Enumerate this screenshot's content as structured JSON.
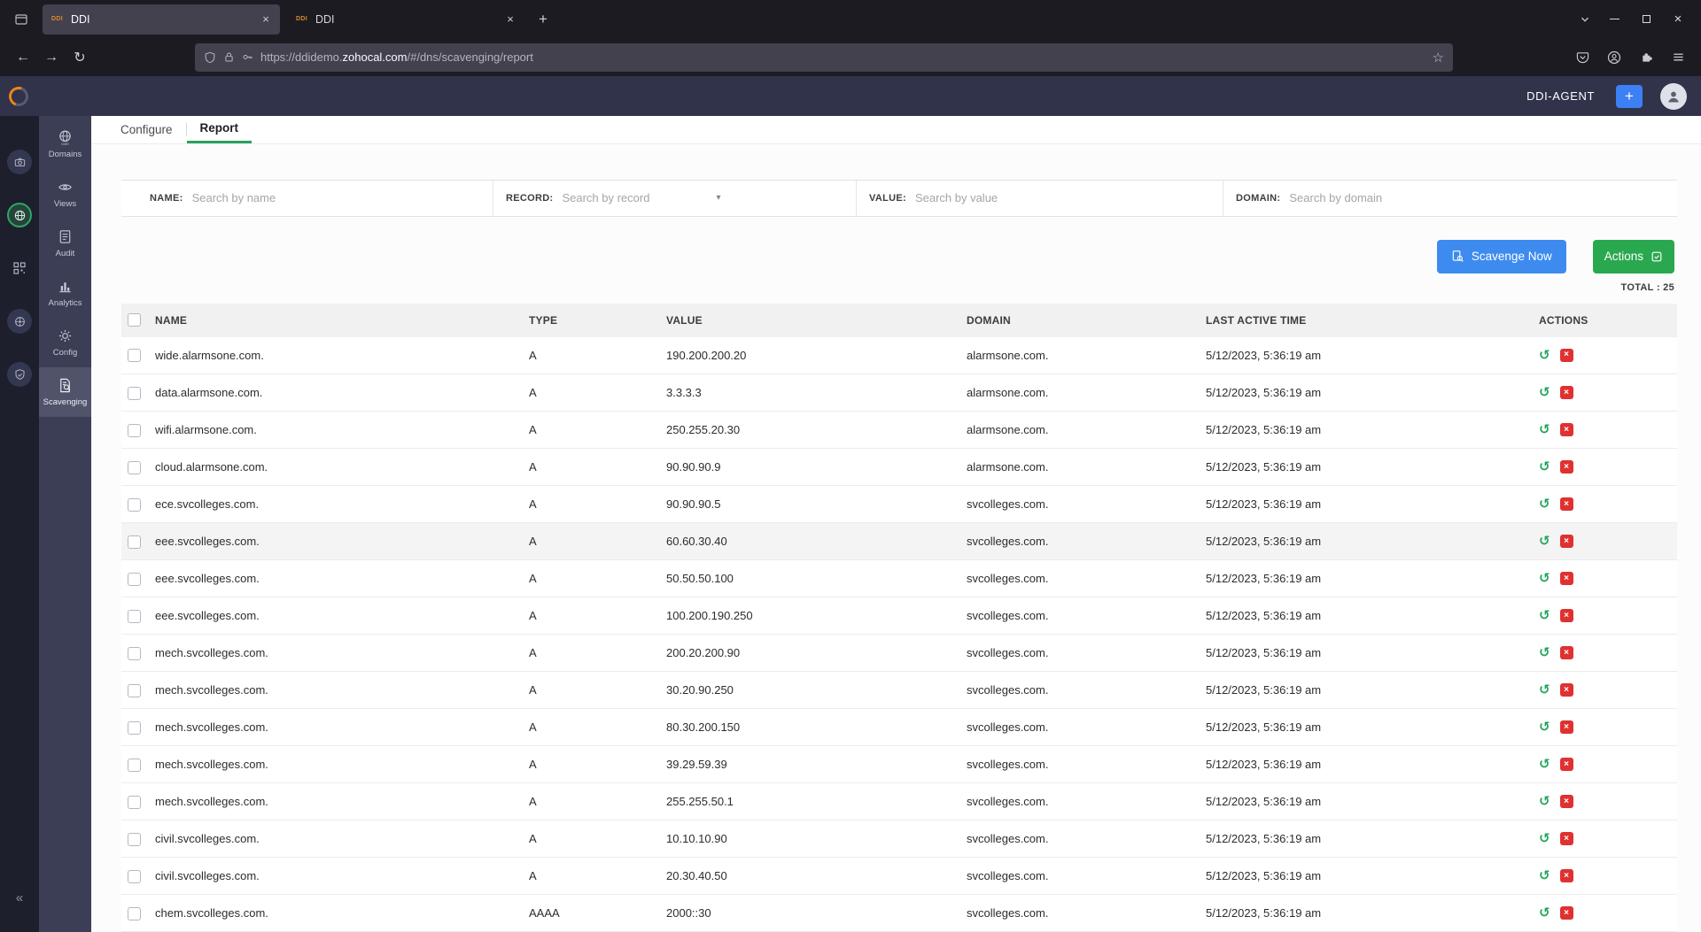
{
  "glyphs": {
    "close": "×",
    "plus": "+",
    "back": "←",
    "forward": "→",
    "reload": "↻",
    "star": "☆",
    "chevron_down": "▾",
    "collapse": "«",
    "restore": "↺"
  },
  "browser": {
    "tabs": [
      {
        "label": "DDI",
        "favicon": "DDI"
      },
      {
        "label": "DDI",
        "favicon": "DDI"
      }
    ],
    "url": {
      "prefix": "https://ddidemo.",
      "domain": "zohocal.com",
      "suffix": "/#/dns/scavenging/report"
    }
  },
  "app_header": {
    "agent": "DDI-AGENT",
    "add": "+"
  },
  "sidebar": {
    "items": [
      {
        "label": "Domains"
      },
      {
        "label": "Views"
      },
      {
        "label": "Audit"
      },
      {
        "label": "Analytics"
      },
      {
        "label": "Config"
      },
      {
        "label": "Scavenging"
      }
    ]
  },
  "page_tabs": {
    "configure": "Configure",
    "report": "Report"
  },
  "filters": {
    "name": {
      "label": "NAME:",
      "placeholder": "Search by name"
    },
    "record": {
      "label": "RECORD:",
      "placeholder": "Search by record"
    },
    "value": {
      "label": "VALUE:",
      "placeholder": "Search by value"
    },
    "domain": {
      "label": "DOMAIN:",
      "placeholder": "Search by domain"
    }
  },
  "toolbar": {
    "scavenge_label": "Scavenge Now",
    "actions_label": "Actions"
  },
  "summary": {
    "total": "TOTAL : 25"
  },
  "table": {
    "columns": [
      "NAME",
      "TYPE",
      "VALUE",
      "DOMAIN",
      "LAST ACTIVE TIME",
      "ACTIONS"
    ],
    "rows": [
      {
        "name": "wide.alarmsone.com.",
        "type": "A",
        "value": "190.200.200.20",
        "domain": "alarmsone.com.",
        "last_active": "5/12/2023, 5:36:19 am"
      },
      {
        "name": "data.alarmsone.com.",
        "type": "A",
        "value": "3.3.3.3",
        "domain": "alarmsone.com.",
        "last_active": "5/12/2023, 5:36:19 am"
      },
      {
        "name": "wifi.alarmsone.com.",
        "type": "A",
        "value": "250.255.20.30",
        "domain": "alarmsone.com.",
        "last_active": "5/12/2023, 5:36:19 am"
      },
      {
        "name": "cloud.alarmsone.com.",
        "type": "A",
        "value": "90.90.90.9",
        "domain": "alarmsone.com.",
        "last_active": "5/12/2023, 5:36:19 am"
      },
      {
        "name": "ece.svcolleges.com.",
        "type": "A",
        "value": "90.90.90.5",
        "domain": "svcolleges.com.",
        "last_active": "5/12/2023, 5:36:19 am"
      },
      {
        "name": "eee.svcolleges.com.",
        "type": "A",
        "value": "60.60.30.40",
        "domain": "svcolleges.com.",
        "last_active": "5/12/2023, 5:36:19 am",
        "highlight": true
      },
      {
        "name": "eee.svcolleges.com.",
        "type": "A",
        "value": "50.50.50.100",
        "domain": "svcolleges.com.",
        "last_active": "5/12/2023, 5:36:19 am"
      },
      {
        "name": "eee.svcolleges.com.",
        "type": "A",
        "value": "100.200.190.250",
        "domain": "svcolleges.com.",
        "last_active": "5/12/2023, 5:36:19 am"
      },
      {
        "name": "mech.svcolleges.com.",
        "type": "A",
        "value": "200.20.200.90",
        "domain": "svcolleges.com.",
        "last_active": "5/12/2023, 5:36:19 am"
      },
      {
        "name": "mech.svcolleges.com.",
        "type": "A",
        "value": "30.20.90.250",
        "domain": "svcolleges.com.",
        "last_active": "5/12/2023, 5:36:19 am"
      },
      {
        "name": "mech.svcolleges.com.",
        "type": "A",
        "value": "80.30.200.150",
        "domain": "svcolleges.com.",
        "last_active": "5/12/2023, 5:36:19 am"
      },
      {
        "name": "mech.svcolleges.com.",
        "type": "A",
        "value": "39.29.59.39",
        "domain": "svcolleges.com.",
        "last_active": "5/12/2023, 5:36:19 am"
      },
      {
        "name": "mech.svcolleges.com.",
        "type": "A",
        "value": "255.255.50.1",
        "domain": "svcolleges.com.",
        "last_active": "5/12/2023, 5:36:19 am"
      },
      {
        "name": "civil.svcolleges.com.",
        "type": "A",
        "value": "10.10.10.90",
        "domain": "svcolleges.com.",
        "last_active": "5/12/2023, 5:36:19 am"
      },
      {
        "name": "civil.svcolleges.com.",
        "type": "A",
        "value": "20.30.40.50",
        "domain": "svcolleges.com.",
        "last_active": "5/12/2023, 5:36:19 am"
      },
      {
        "name": "chem.svcolleges.com.",
        "type": "AAAA",
        "value": "2000::30",
        "domain": "svcolleges.com.",
        "last_active": "5/12/2023, 5:36:19 am"
      }
    ]
  }
}
